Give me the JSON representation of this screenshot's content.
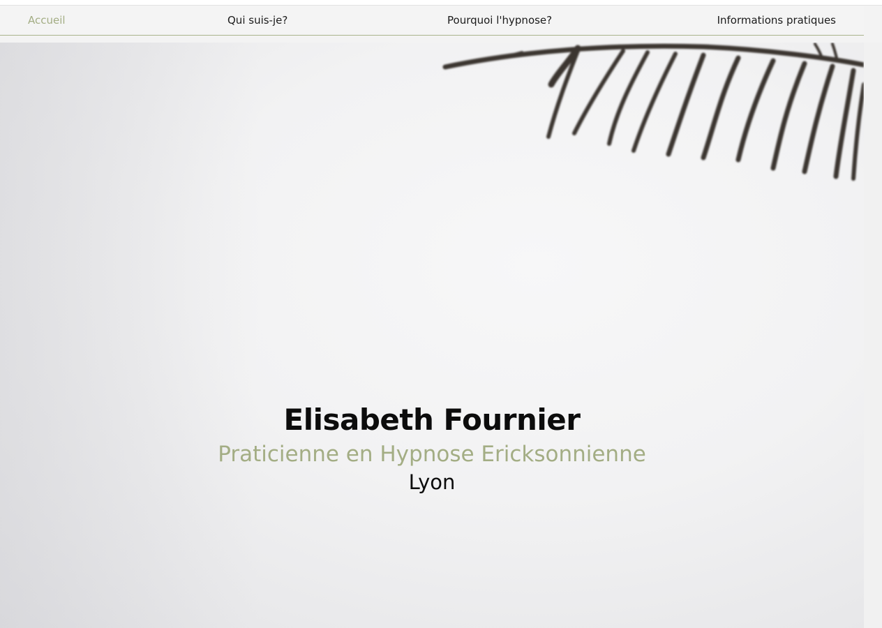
{
  "nav": {
    "items": [
      {
        "label": "Accueil",
        "active": true
      },
      {
        "label": "Qui suis-je?",
        "active": false
      },
      {
        "label": "Pourquoi l'hypnose?",
        "active": false
      },
      {
        "label": "Informations pratiques",
        "active": false
      }
    ]
  },
  "hero": {
    "name": "Elisabeth Fournier",
    "subtitle": "Praticienne en Hypnose Ericksonnienne",
    "city": "Lyon"
  },
  "colors": {
    "accent": "#a3ad84",
    "text": "#0c0c0c",
    "background": "#f3f3f3"
  }
}
